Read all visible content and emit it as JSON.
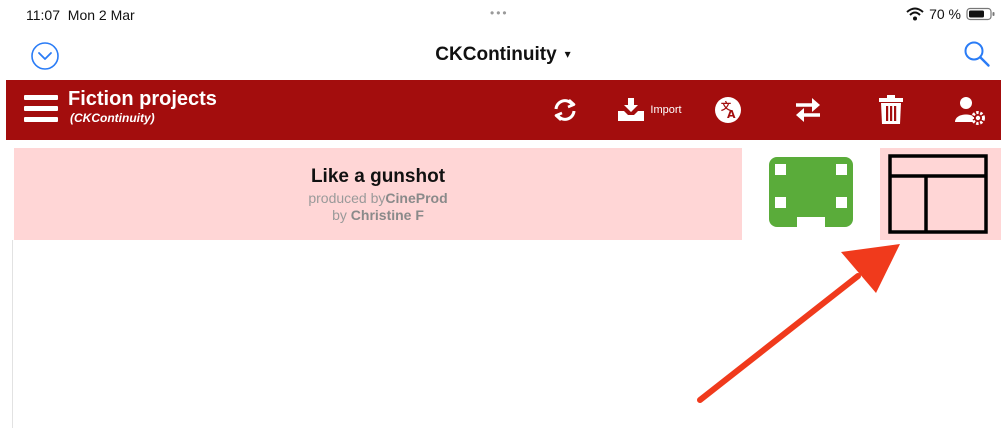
{
  "status_bar": {
    "time": "11:07",
    "date": "Mon 2 Mar",
    "dots": "•••",
    "battery_text": "70 %"
  },
  "nav": {
    "title": "CKContinuity",
    "caret": "▾",
    "left_icon": "chevron-down-circle-icon",
    "right_icon": "search-icon"
  },
  "toolbar": {
    "title": "Fiction projects",
    "subtitle": "(CKContinuity)",
    "import_label": "Import",
    "background_color": "#a30d0d",
    "buttons": [
      "sync-icon",
      "import-icon",
      "translate-icon",
      "swap-icon",
      "trash-icon",
      "user-settings-icon"
    ]
  },
  "project": {
    "title": "Like a gunshot",
    "produced_prefix": "produced by",
    "producer": "CineProd",
    "by_prefix": "by ",
    "author": "Christine F",
    "row_color": "#ffd6d6",
    "film_icon_color": "#5aac3a"
  },
  "annotation": {
    "arrow_color": "#f03a1c",
    "points_to": "layout-icon"
  }
}
